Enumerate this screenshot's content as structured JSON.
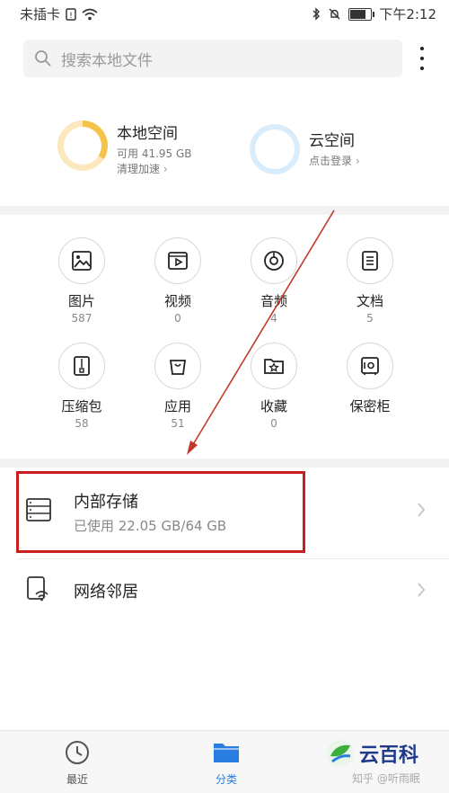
{
  "status_bar": {
    "carrier": "未插卡",
    "time": "下午2:12",
    "battery_level": 0.8
  },
  "search": {
    "placeholder": "搜索本地文件"
  },
  "storage": {
    "local": {
      "title": "本地空间",
      "available": "可用 41.95 GB",
      "action": "清理加速",
      "used_fraction": 0.34
    },
    "cloud": {
      "title": "云空间",
      "action": "点击登录"
    }
  },
  "categories": [
    {
      "label": "图片",
      "count": "587",
      "icon": "image-icon"
    },
    {
      "label": "视频",
      "count": "0",
      "icon": "video-icon"
    },
    {
      "label": "音频",
      "count": "4",
      "icon": "audio-icon"
    },
    {
      "label": "文档",
      "count": "5",
      "icon": "document-icon"
    },
    {
      "label": "压缩包",
      "count": "58",
      "icon": "archive-icon"
    },
    {
      "label": "应用",
      "count": "51",
      "icon": "app-bag-icon"
    },
    {
      "label": "收藏",
      "count": "0",
      "icon": "star-folder-icon"
    },
    {
      "label": "保密柜",
      "count": "",
      "icon": "safe-icon"
    }
  ],
  "internal_storage": {
    "title": "内部存储",
    "usage": "已使用 22.05 GB/64 GB"
  },
  "network": {
    "title": "网络邻居"
  },
  "bottom_nav": {
    "recent": "最近",
    "categories": "分类"
  },
  "watermark": {
    "logo_text": "云百科",
    "credit": "知乎 @听雨眠"
  },
  "colors": {
    "accent": "#2a7de1",
    "ring_local": "#f5c24a",
    "ring_cloud": "#d9ecfb",
    "highlight_box": "#c81e1e",
    "arrow": "#c0392b"
  }
}
